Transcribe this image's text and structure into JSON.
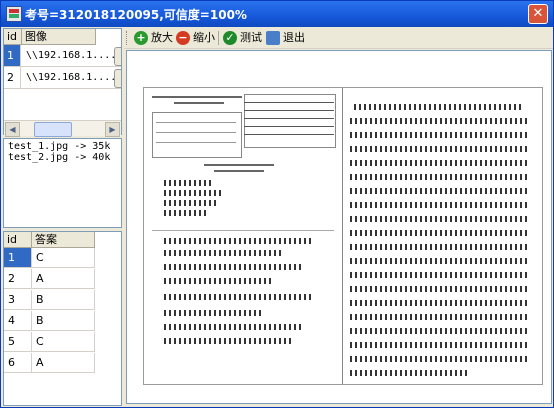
{
  "window": {
    "title": "考号=312018120095,可信度=100%",
    "close_label": "✕"
  },
  "image_grid": {
    "headers": {
      "id": "id",
      "image": "图像"
    },
    "rows": [
      {
        "id": "1",
        "image": "\\\\192.168.1...."
      },
      {
        "id": "2",
        "image": "\\\\192.168.1...."
      }
    ]
  },
  "log": {
    "lines": [
      "test_1.jpg -> 35k",
      "test_2.jpg -> 40k"
    ]
  },
  "answer_grid": {
    "headers": {
      "id": "id",
      "answer": "答案"
    },
    "rows": [
      {
        "id": "1",
        "answer": "C"
      },
      {
        "id": "2",
        "answer": "A"
      },
      {
        "id": "3",
        "answer": "B"
      },
      {
        "id": "4",
        "answer": "B"
      },
      {
        "id": "5",
        "answer": "C"
      },
      {
        "id": "6",
        "answer": "A"
      }
    ]
  },
  "toolbar": {
    "zoom_in": "放大",
    "zoom_out": "缩小",
    "test": "测试",
    "exit": "退出"
  },
  "icons": {
    "zoom_in": "plus-icon",
    "zoom_out": "minus-icon",
    "test": "check-icon",
    "exit": "exit-icon"
  },
  "colors": {
    "titlebar": "#1658d9",
    "selection": "#316ac5"
  }
}
